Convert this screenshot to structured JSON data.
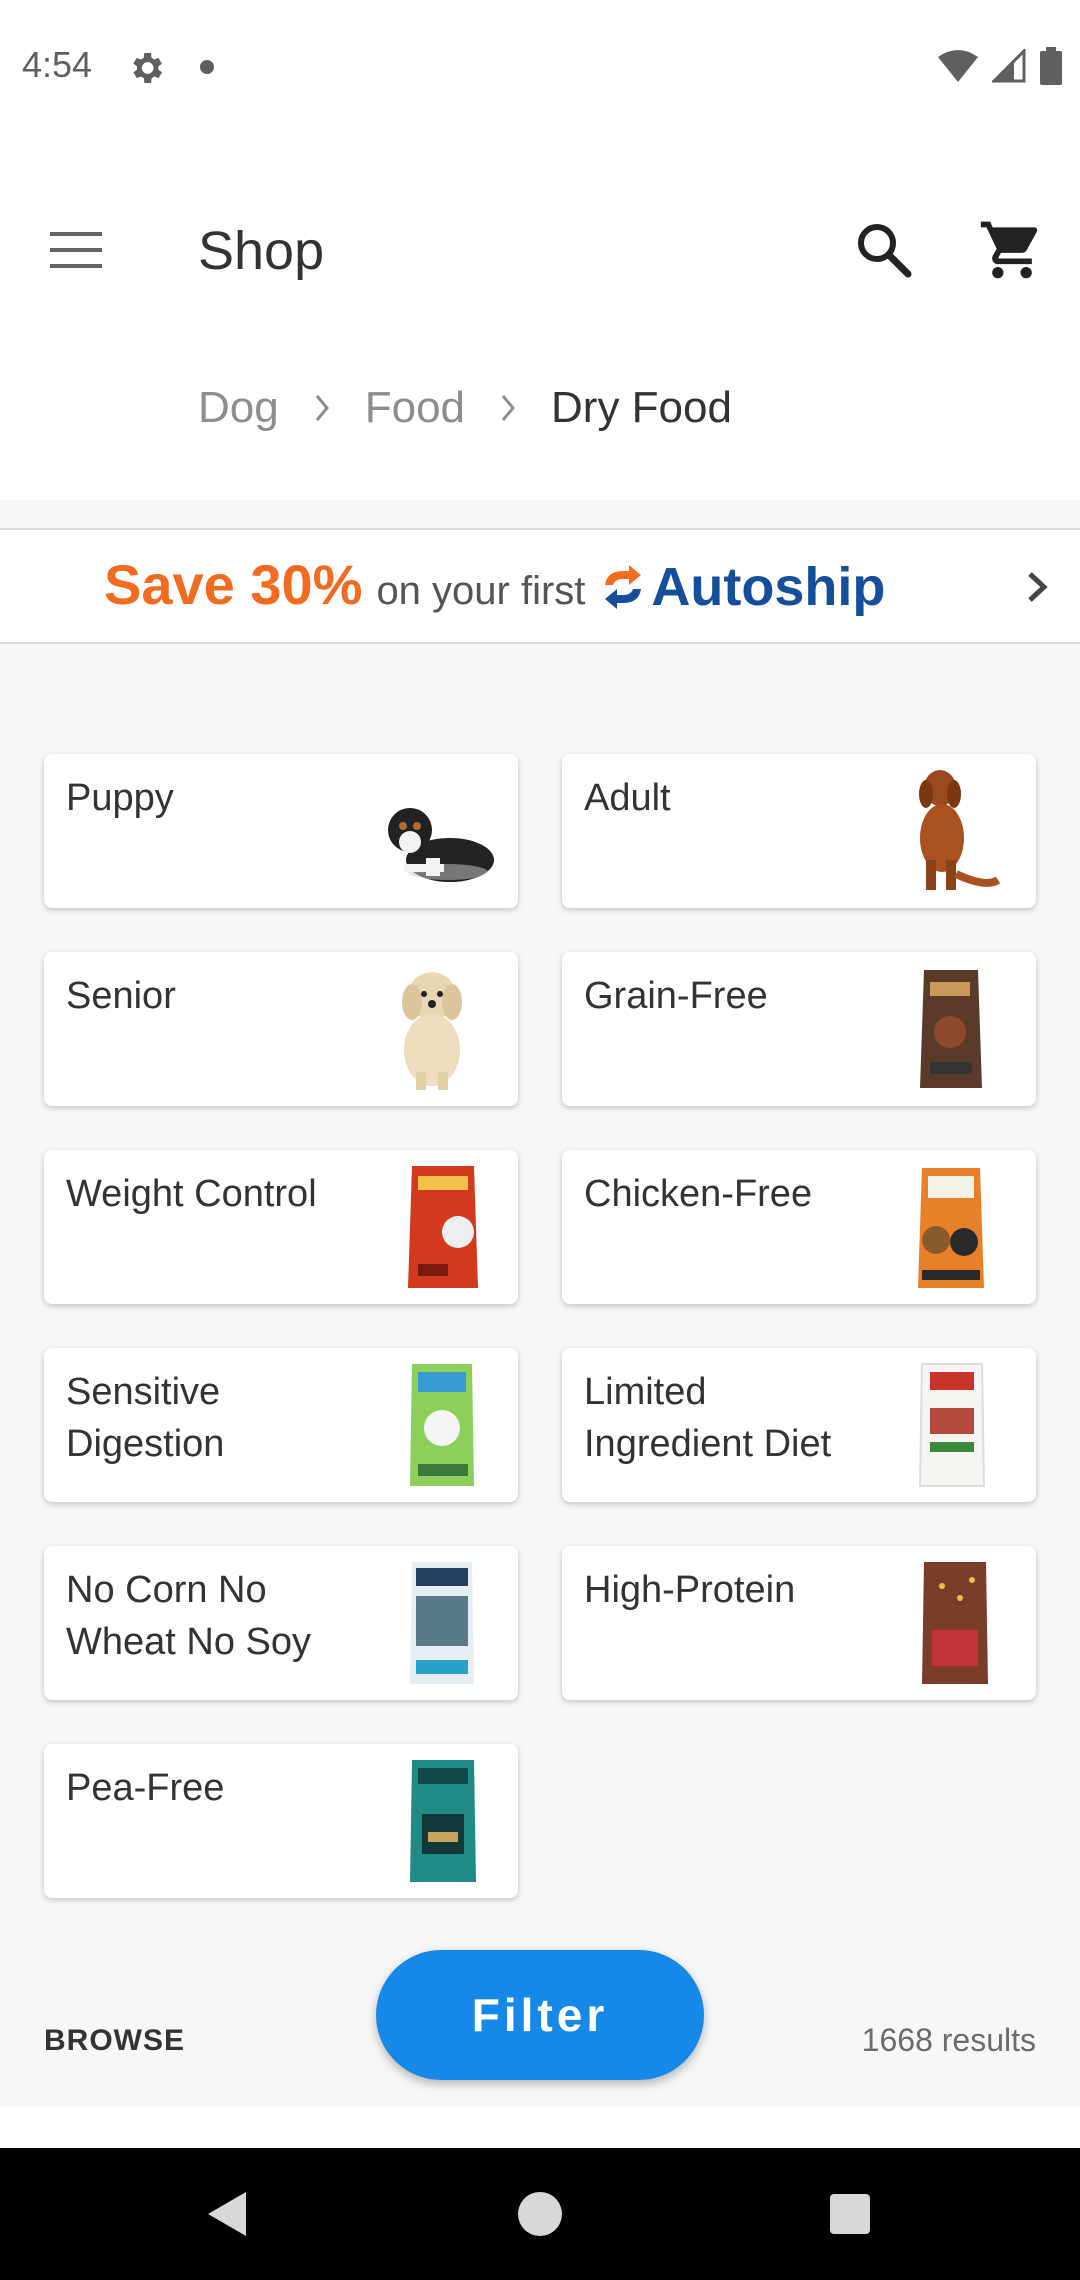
{
  "status_bar": {
    "time": "4:54",
    "icons": [
      "gear-icon",
      "notification-dot-icon",
      "wifi-icon",
      "signal-icon",
      "battery-icon"
    ]
  },
  "app_bar": {
    "title": "Shop",
    "icons": [
      "menu-icon",
      "search-icon",
      "cart-icon"
    ]
  },
  "breadcrumb": {
    "items": [
      "Dog",
      "Food",
      "Dry Food"
    ]
  },
  "banner": {
    "save": "Save 30%",
    "text": "on your first",
    "brand": "Autoship",
    "colors": {
      "save": "#f26b21",
      "brand": "#154e9a"
    }
  },
  "categories": [
    {
      "label": "Puppy",
      "icon": "puppy-image"
    },
    {
      "label": "Adult",
      "icon": "adult-dog-image"
    },
    {
      "label": "Senior",
      "icon": "senior-dog-image"
    },
    {
      "label": "Grain-Free",
      "icon": "food-bag-image"
    },
    {
      "label": "Weight Control",
      "icon": "food-bag-image"
    },
    {
      "label": "Chicken-Free",
      "icon": "food-bag-image"
    },
    {
      "label": "Sensitive Digestion",
      "icon": "food-bag-image"
    },
    {
      "label": "Limited Ingredient Diet",
      "icon": "food-bag-image"
    },
    {
      "label": "No Corn No Wheat No Soy",
      "icon": "food-bag-image"
    },
    {
      "label": "High-Protein",
      "icon": "food-bag-image"
    },
    {
      "label": "Pea-Free",
      "icon": "food-bag-image"
    }
  ],
  "bottom": {
    "browse": "BROWSE",
    "filter": "Filter",
    "results": "1668 results",
    "accent": "#1689e8"
  }
}
